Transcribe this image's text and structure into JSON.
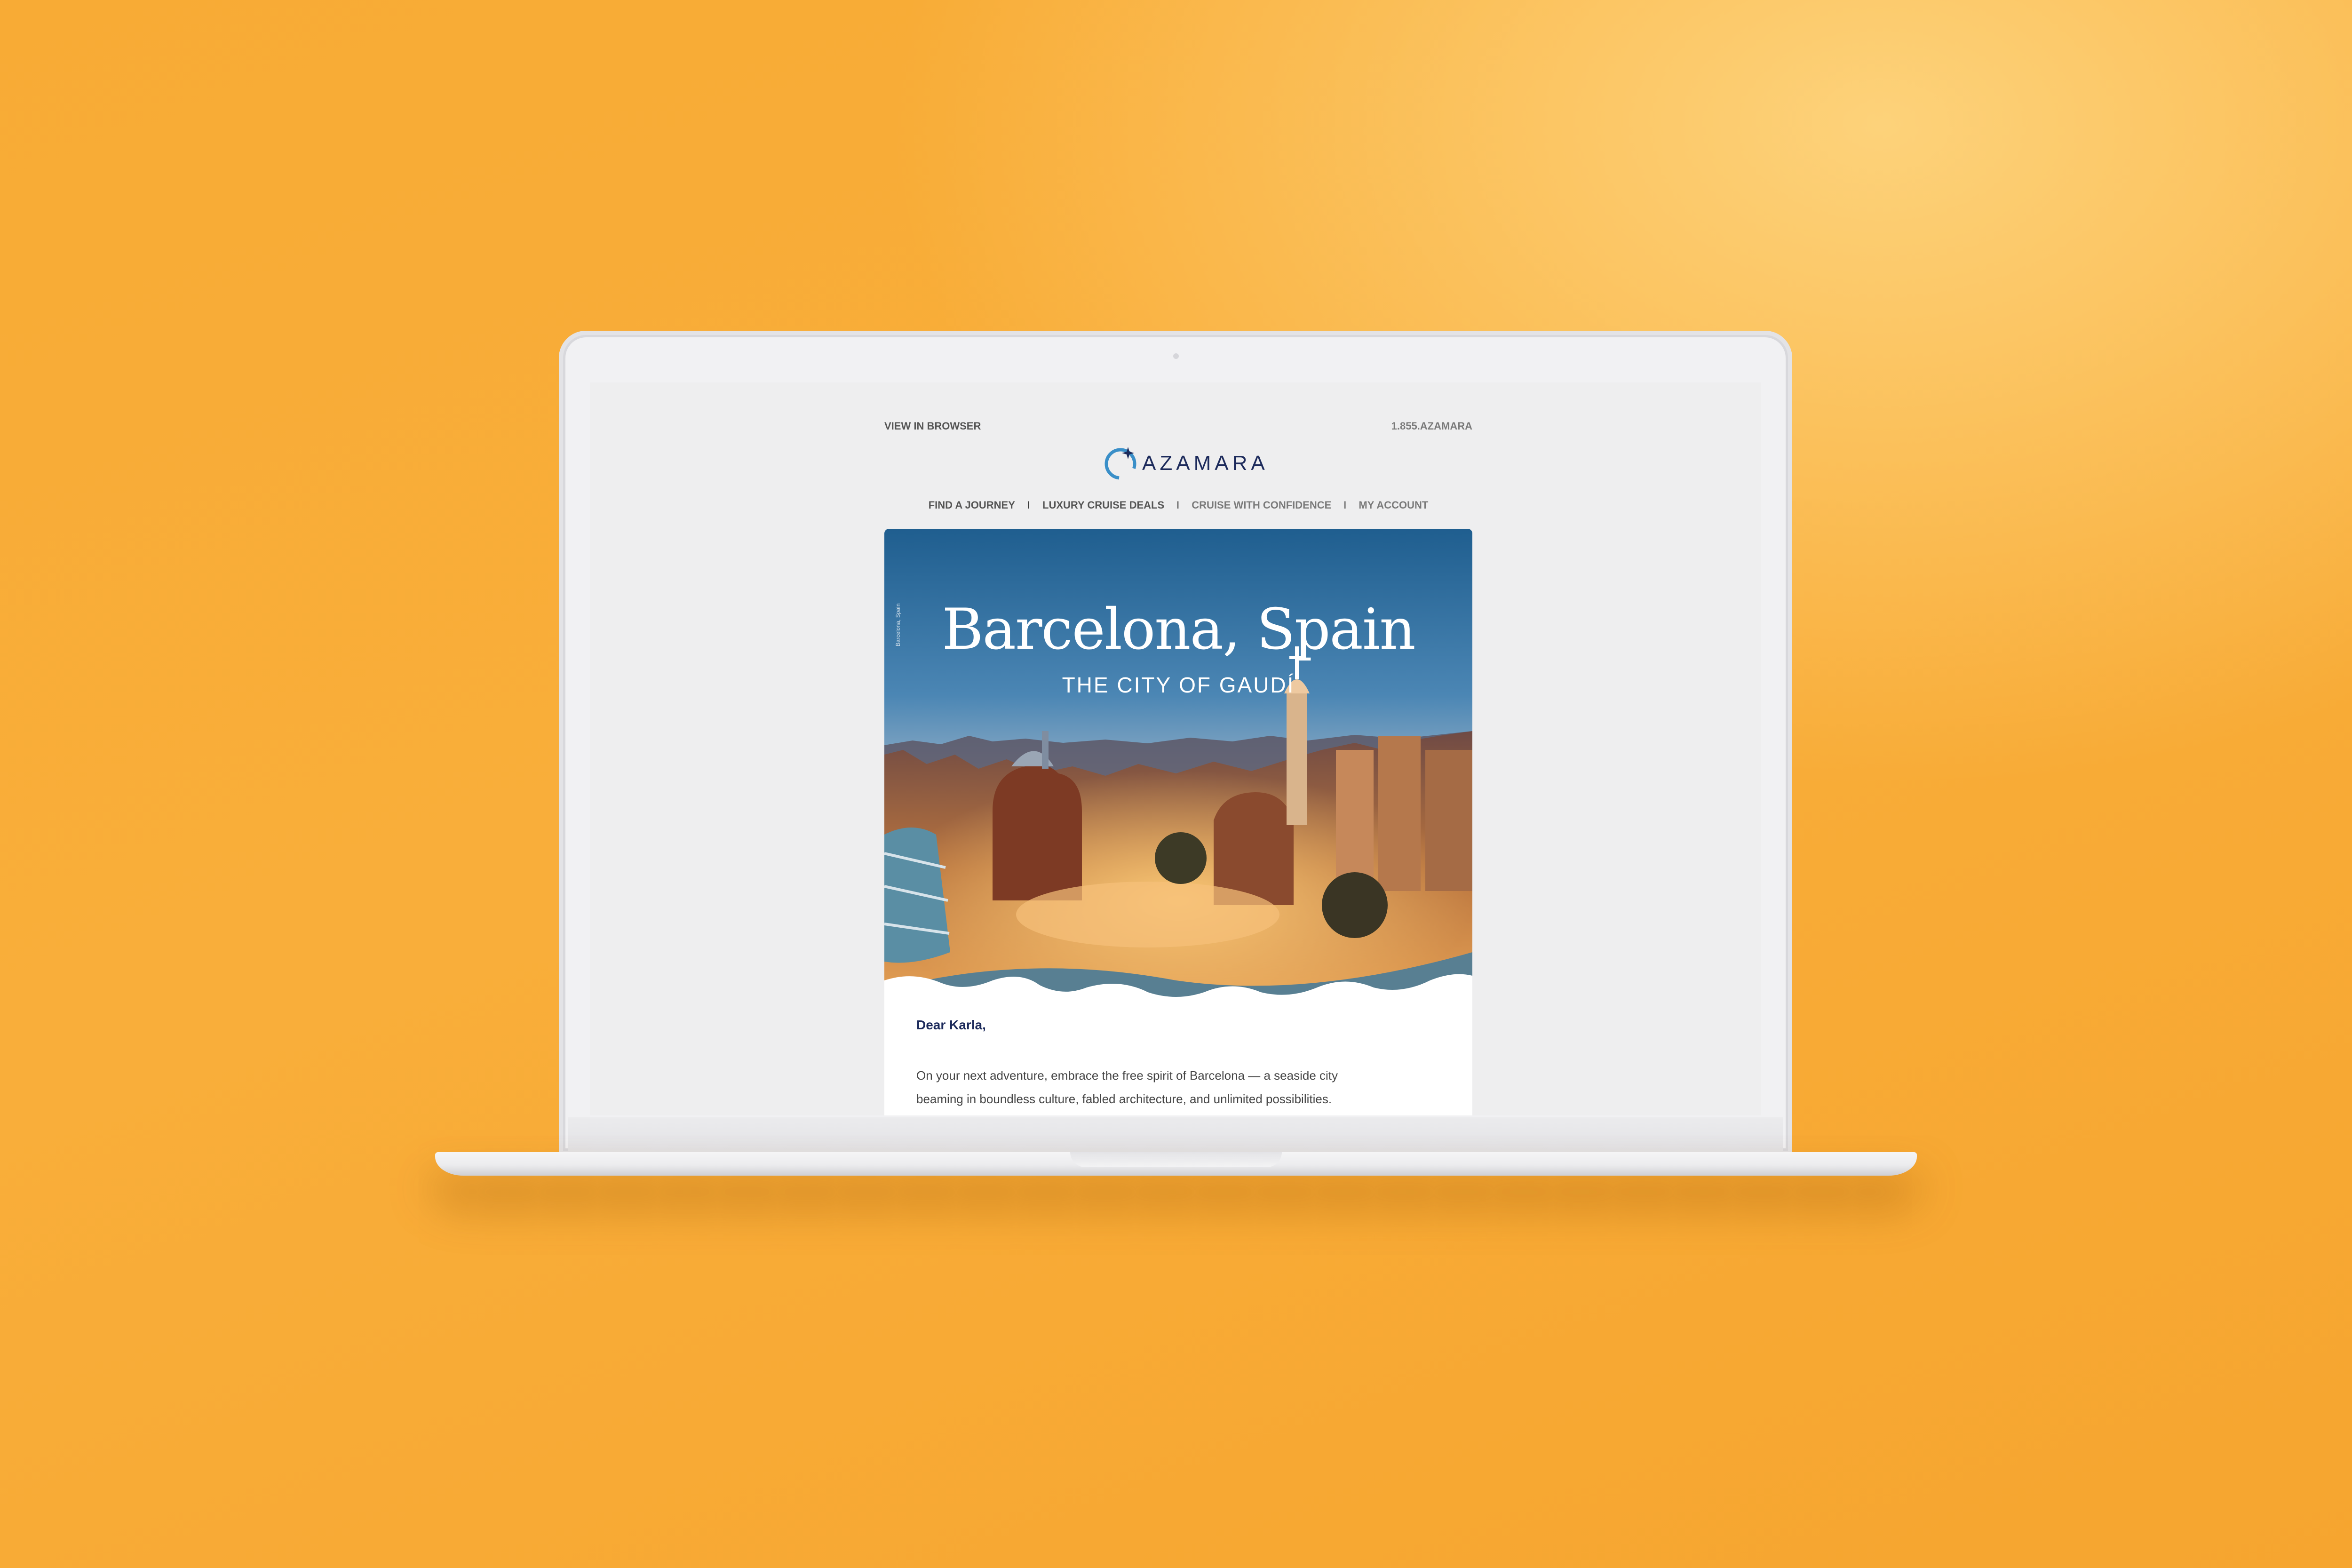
{
  "email": {
    "view_in_browser": "VIEW IN BROWSER",
    "phone": "1.855.AZAMARA",
    "logo_text": "AZAMARA",
    "nav": [
      {
        "label": "FIND A JOURNEY"
      },
      {
        "label": "LUXURY CRUISE DEALS"
      },
      {
        "label": "CRUISE WITH CONFIDENCE"
      },
      {
        "label": "MY ACCOUNT"
      }
    ],
    "nav_separator": "I",
    "hero": {
      "title": "Barcelona, Spain",
      "subtitle": "THE CITY OF GAUDÍ",
      "photo_caption": "Barcelona, Spain"
    },
    "greeting": "Dear Karla,",
    "paragraph_line1": "On your next adventure, embrace the free spirit of Barcelona — a seaside city",
    "paragraph_line2": "beaming in boundless culture, fabled architecture, and unlimited possibilities."
  },
  "colors": {
    "background": "#f8ab35",
    "brand_navy": "#1c2a5b",
    "logo_accent": "#3a8fc8"
  },
  "icons": {
    "logo": "azamara-compass-logo-icon"
  }
}
